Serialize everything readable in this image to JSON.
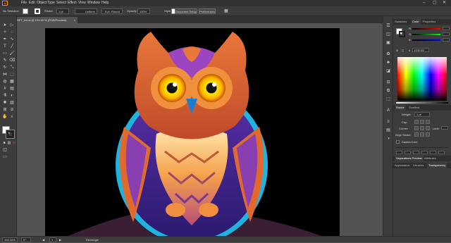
{
  "app": {
    "logo": "Ai"
  },
  "menubar": {
    "items": [
      "File",
      "Edit",
      "Object",
      "Type",
      "Select",
      "Effect",
      "View",
      "Window",
      "Help"
    ]
  },
  "control_bar": {
    "selection": "No Selection",
    "stroke_label": "Stroke:",
    "stroke_value": "1 pt",
    "uniform": "Uniform",
    "brush": "5 pt. Round",
    "opacity_label": "Opacity:",
    "opacity_value": "100%",
    "style_label": "Style:",
    "doc_setup": "Document Setup",
    "preferences": "Preferences"
  },
  "document": {
    "tab_title": "NFT_Art.ai @ 104.16 % (RGB/Preview)",
    "close": "×"
  },
  "status": {
    "zoom": "104.16%",
    "rotation": "0°",
    "artboard": "1",
    "tool": "Rectangle"
  },
  "panels": {
    "top_tabs": [
      "Swatches",
      "Color",
      "Properties"
    ],
    "active_top_tab": "Color",
    "hex_value": "FFFFFF",
    "stroke_tabs": [
      "Stroke",
      "Gradient"
    ],
    "weight_label": "Weight:",
    "weight_value": "1 pt",
    "cap_label": "Cap:",
    "corner_label": "Corner:",
    "limit_label": "Limit:",
    "align_stroke_label": "Align Stroke:",
    "dashed_label": "Dashed Line",
    "sep_tabs": [
      "Separations Preview",
      "Attributes"
    ],
    "bottom_tabs": [
      "Appearance",
      "Libraries",
      "Transparency"
    ]
  },
  "colors": {
    "accent": "#ff9a00",
    "panel_bg": "#3c3c3c",
    "canvas_bg": "#535353",
    "artboard_bg": "#000000"
  }
}
